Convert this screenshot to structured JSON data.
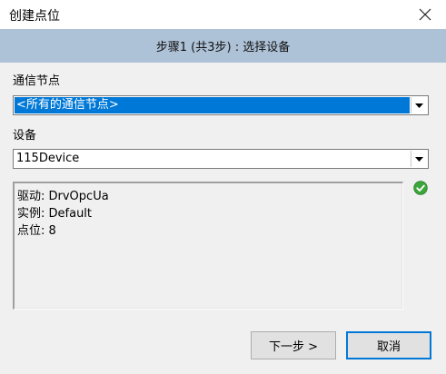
{
  "window": {
    "title": "创建点位"
  },
  "banner": {
    "step_text": "步骤1 (共3步) : 选择设备"
  },
  "comm_node": {
    "label": "通信节点",
    "selected_value": "<所有的通信节点>"
  },
  "device": {
    "label": "设备",
    "selected_value": "115Device"
  },
  "info": {
    "lines": [
      "驱动: DrvOpcUa",
      "实例: Default",
      "点位: 8"
    ]
  },
  "status_icon": "green-check-icon",
  "buttons": {
    "next": "下一步 >",
    "cancel": "取消"
  },
  "colors": {
    "banner": "#aec2d7",
    "selection": "#0078d7",
    "check": "#3ca63c"
  }
}
